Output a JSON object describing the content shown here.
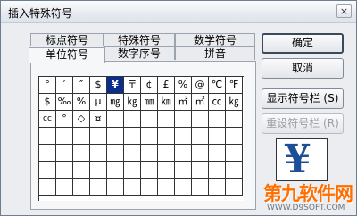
{
  "window": {
    "title": "插入特殊符号",
    "close_glyph": "×"
  },
  "tabs": {
    "row1": [
      "标点符号",
      "特殊符号",
      "数学符号"
    ],
    "row2": [
      "单位符号",
      "数字序号",
      "拼音"
    ],
    "active": "单位符号"
  },
  "symbols": [
    [
      "°",
      "′",
      "″",
      "$",
      "¥",
      "〒",
      "¢",
      "£",
      "%",
      "@",
      "℃",
      "℉"
    ],
    [
      "$",
      "‰",
      "%",
      "µ",
      "㎎",
      "㎏",
      "㎜",
      "㎞",
      "㎡",
      "㎡",
      "㏄",
      "㎏"
    ],
    [
      "cc",
      "°",
      "◇",
      "¤",
      "",
      "",
      "",
      "",
      "",
      "",
      "",
      ""
    ],
    [
      "",
      "",
      "",
      "",
      "",
      "",
      "",
      "",
      "",
      "",
      "",
      ""
    ],
    [
      "",
      "",
      "",
      "",
      "",
      "",
      "",
      "",
      "",
      "",
      "",
      ""
    ],
    [
      "",
      "",
      "",
      "",
      "",
      "",
      "",
      "",
      "",
      "",
      "",
      ""
    ],
    [
      "",
      "",
      "",
      "",
      "",
      "",
      "",
      "",
      "",
      "",
      "",
      ""
    ]
  ],
  "selected_symbol": "¥",
  "buttons": {
    "ok": "确定",
    "cancel": "取消",
    "show_bar": "显示符号栏 (S)",
    "reset_bar": "重设符号栏 (R)"
  },
  "preview": {
    "char": "¥"
  },
  "watermark": {
    "text": "第九软件网",
    "url": "WWW.D9SOFT.COM"
  }
}
